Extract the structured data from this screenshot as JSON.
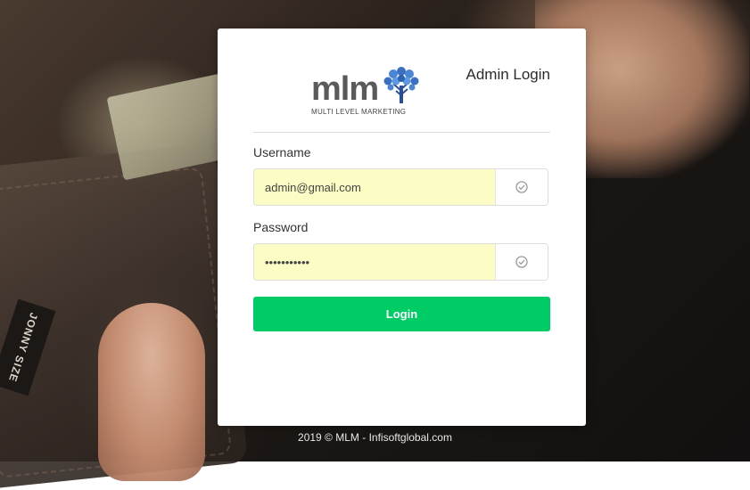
{
  "brand": {
    "logo_text": "mlm",
    "logo_subtitle": "MULTI LEVEL MARKETING",
    "logo_tree_color": "#2f5fb0",
    "background_tag": "JONNY SIZE"
  },
  "header": {
    "title": "Admin Login"
  },
  "form": {
    "username_label": "Username",
    "username_value": "admin@gmail.com",
    "password_label": "Password",
    "password_value": "adminadmin1",
    "field_icon": "check-circle-icon",
    "autofill_color": "#fbfdc4",
    "login_label": "Login",
    "login_color": "#00cc66"
  },
  "footer": {
    "text": "2019 © MLM - Infisoftglobal.com"
  }
}
